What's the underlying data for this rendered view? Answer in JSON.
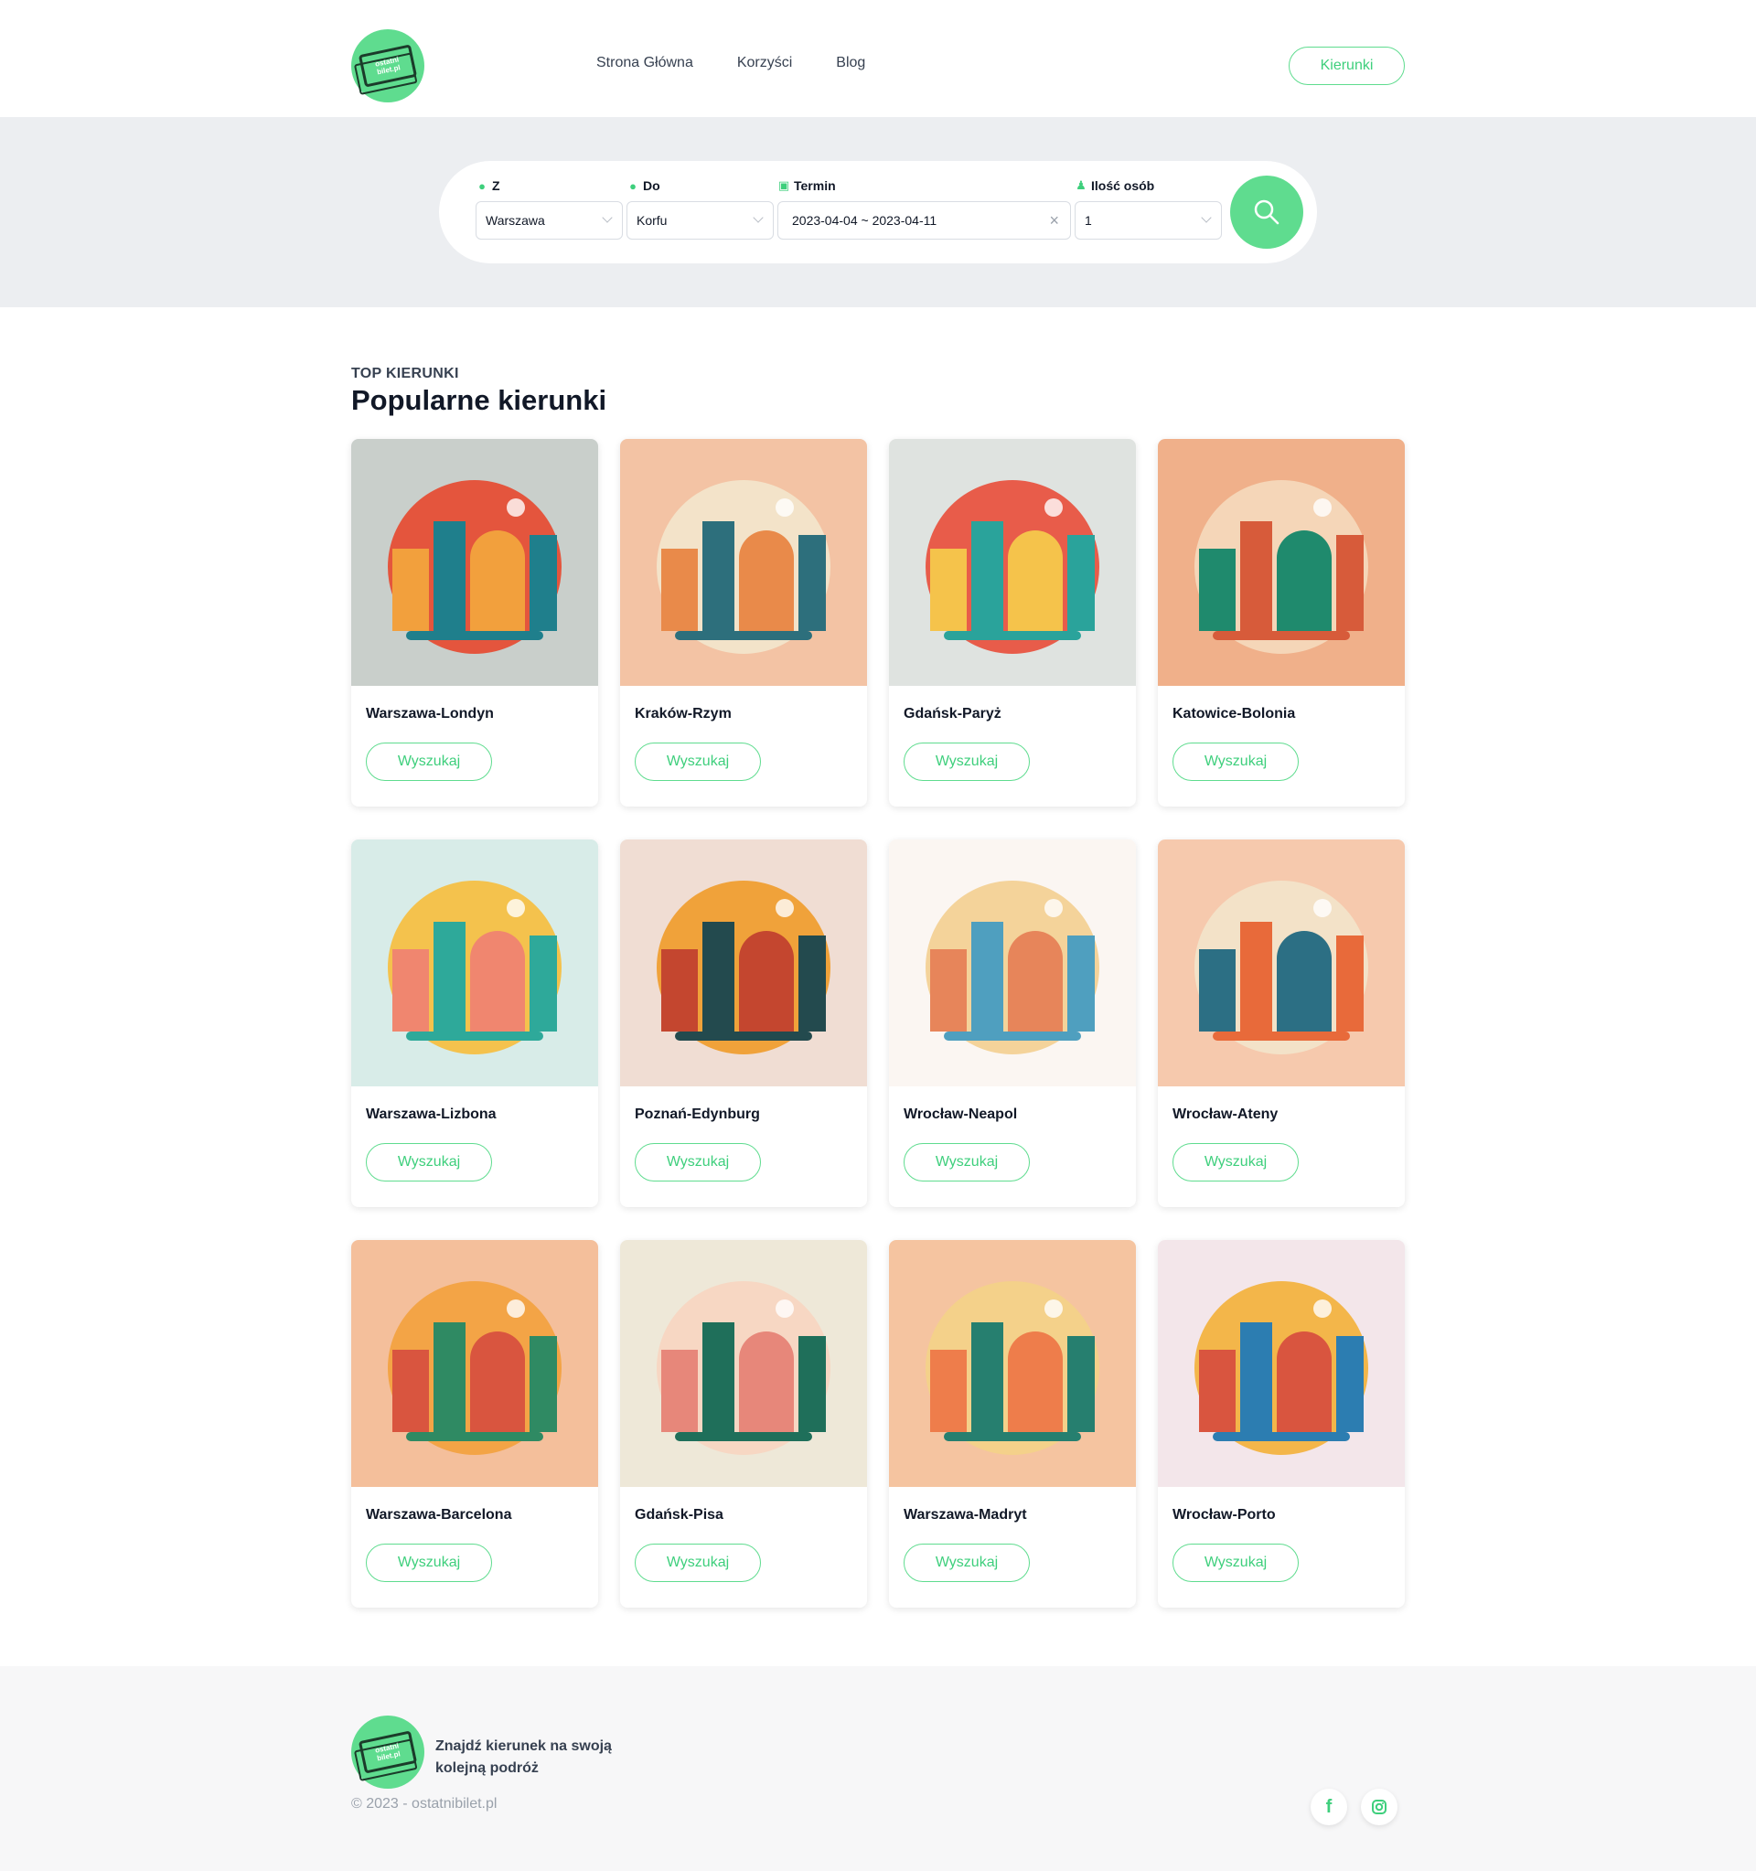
{
  "brand": {
    "logo_text": "ostatni\nbilet.pl",
    "accent": "#5fdc8f"
  },
  "nav": {
    "items": [
      "Strona Główna",
      "Korzyści",
      "Blog"
    ],
    "cta": "Kierunki"
  },
  "search": {
    "from": {
      "label": "Z",
      "value": "Warszawa"
    },
    "to": {
      "label": "Do",
      "value": "Korfu"
    },
    "date": {
      "label": "Termin",
      "value": "2023-04-04 ~ 2023-04-11"
    },
    "people": {
      "label": "Ilość osób",
      "value": "1"
    }
  },
  "section": {
    "eyebrow": "TOP KIERUNKI",
    "title": "Popularne kierunki"
  },
  "cards": [
    {
      "title": "Warszawa-Londyn",
      "button": "Wyszukaj",
      "bg": "#c9cfcb",
      "c1": "#f2a03d",
      "c2": "#1f7f8c",
      "c3": "#e4553d"
    },
    {
      "title": "Kraków-Rzym",
      "button": "Wyszukaj",
      "bg": "#f3c3a4",
      "c1": "#e98a4a",
      "c2": "#2d6f7c",
      "c3": "#f3e3c9"
    },
    {
      "title": "Gdańsk-Paryż",
      "button": "Wyszukaj",
      "bg": "#dfe3e0",
      "c1": "#f5c34b",
      "c2": "#2aa39b",
      "c3": "#e85c4a"
    },
    {
      "title": "Katowice-Bolonia",
      "button": "Wyszukaj",
      "bg": "#f0b08a",
      "c1": "#1f8a6d",
      "c2": "#d75b3a",
      "c3": "#f5d6b8"
    },
    {
      "title": "Warszawa-Lizbona",
      "button": "Wyszukaj",
      "bg": "#d8ece8",
      "c1": "#f0866f",
      "c2": "#2ea99a",
      "c3": "#f4c24d"
    },
    {
      "title": "Poznań-Edynburg",
      "button": "Wyszukaj",
      "bg": "#f0ddd3",
      "c1": "#c4462f",
      "c2": "#234a4e",
      "c3": "#f0a23a"
    },
    {
      "title": "Wrocław-Neapol",
      "button": "Wyszukaj",
      "bg": "#fbf6f2",
      "c1": "#e7855a",
      "c2": "#4f9fbf",
      "c3": "#f4d39a"
    },
    {
      "title": "Wrocław-Ateny",
      "button": "Wyszukaj",
      "bg": "#f6c9ad",
      "c1": "#2c6f84",
      "c2": "#e86a3a",
      "c3": "#f3e2c8"
    },
    {
      "title": "Warszawa-Barcelona",
      "button": "Wyszukaj",
      "bg": "#f4bf9b",
      "c1": "#d9553f",
      "c2": "#2f8a63",
      "c3": "#f3a446"
    },
    {
      "title": "Gdańsk-Pisa",
      "button": "Wyszukaj",
      "bg": "#eee8d8",
      "c1": "#e7877a",
      "c2": "#1f6f5a",
      "c3": "#f7d7c3"
    },
    {
      "title": "Warszawa-Madryt",
      "button": "Wyszukaj",
      "bg": "#f5c4a0",
      "c1": "#ee7d4b",
      "c2": "#267f6f",
      "c3": "#f4d18a"
    },
    {
      "title": "Wrocław-Porto",
      "button": "Wyszukaj",
      "bg": "#f3e6ea",
      "c1": "#d9553f",
      "c2": "#2c7db1",
      "c3": "#f3b64a"
    }
  ],
  "footer": {
    "tagline": "Znajdź kierunek na swoją kolejną podróż",
    "copyright": "© 2023 - ostatnibilet.pl",
    "social": [
      "facebook-icon",
      "instagram-icon"
    ]
  }
}
